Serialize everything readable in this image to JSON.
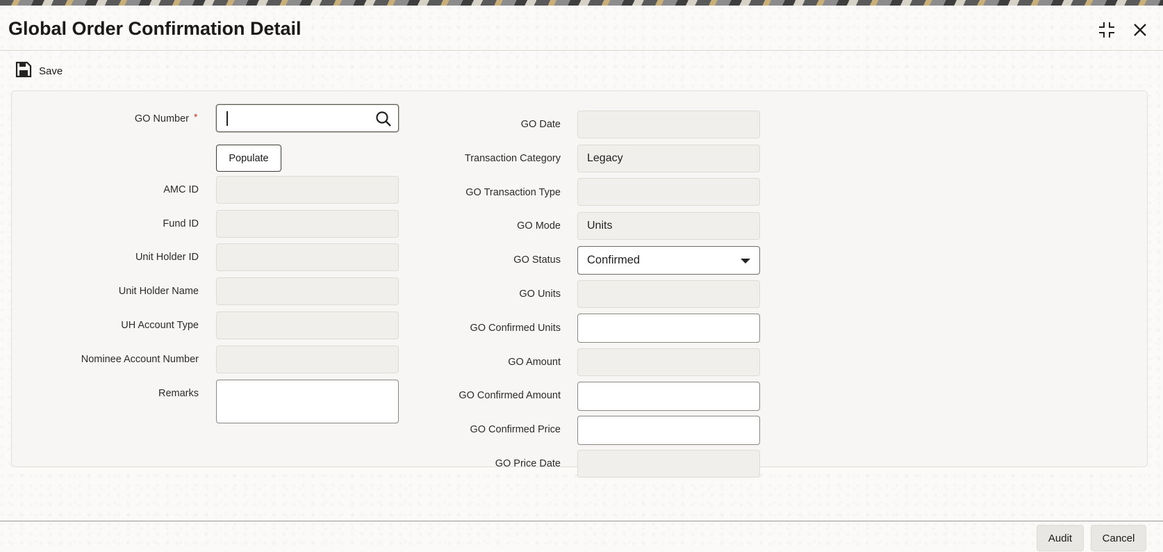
{
  "window": {
    "title": "Global Order Confirmation Detail",
    "maximize_icon": "maximize-icon",
    "close_icon": "close-icon"
  },
  "toolbar": {
    "save_label": "Save",
    "save_icon": "floppy-disk-icon"
  },
  "left": {
    "go_number": {
      "label": "GO Number",
      "required_mark": "*",
      "value": ""
    },
    "populate_label": "Populate",
    "amc_id": {
      "label": "AMC ID",
      "value": ""
    },
    "fund_id": {
      "label": "Fund ID",
      "value": ""
    },
    "unit_holder_id": {
      "label": "Unit Holder ID",
      "value": ""
    },
    "unit_holder_name": {
      "label": "Unit Holder Name",
      "value": ""
    },
    "uh_account_type": {
      "label": "UH Account Type",
      "value": ""
    },
    "nominee_account_number": {
      "label": "Nominee Account Number",
      "value": ""
    },
    "remarks": {
      "label": "Remarks",
      "value": ""
    }
  },
  "right": {
    "go_date": {
      "label": "GO Date",
      "value": ""
    },
    "transaction_category": {
      "label": "Transaction Category",
      "value": "Legacy"
    },
    "go_transaction_type": {
      "label": "GO Transaction Type",
      "value": ""
    },
    "go_mode": {
      "label": "GO Mode",
      "value": "Units"
    },
    "go_status": {
      "label": "GO Status",
      "value": "Confirmed"
    },
    "go_units": {
      "label": "GO Units",
      "value": ""
    },
    "go_confirmed_units": {
      "label": "GO Confirmed Units",
      "value": ""
    },
    "go_amount": {
      "label": "GO Amount",
      "value": ""
    },
    "go_confirmed_amount": {
      "label": "GO Confirmed Amount",
      "value": ""
    },
    "go_confirmed_price": {
      "label": "GO Confirmed Price",
      "value": ""
    },
    "go_price_date": {
      "label": "GO Price Date",
      "value": ""
    }
  },
  "footer": {
    "audit_label": "Audit",
    "cancel_label": "Cancel"
  }
}
